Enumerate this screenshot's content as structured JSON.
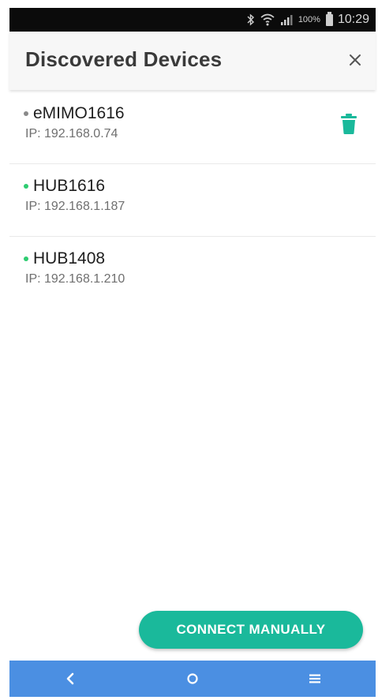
{
  "status_bar": {
    "icons": [
      "bluetooth-icon",
      "wifi-icon",
      "signal-icon",
      "battery-icon"
    ],
    "battery": "100%",
    "time": "10:29"
  },
  "header": {
    "title": "Discovered Devices",
    "close_icon": "close-icon"
  },
  "devices": [
    {
      "name": "eMIMO1616",
      "ip": "IP: 192.168.0.74",
      "status_color": "#8a8a8a",
      "status": "offline",
      "deletable": true
    },
    {
      "name": "HUB1616",
      "ip": "IP: 192.168.1.187",
      "status_color": "#2ecc71",
      "status": "online",
      "deletable": false
    },
    {
      "name": "HUB1408",
      "ip": "IP: 192.168.1.210",
      "status_color": "#2ecc71",
      "status": "online",
      "deletable": false
    }
  ],
  "connect_button": {
    "label": "CONNECT MANUALLY"
  },
  "nav_bar": {
    "icons": [
      "back-icon",
      "home-icon",
      "menu-icon"
    ]
  },
  "colors": {
    "accent": "#1ab99b",
    "nav_bar": "#4b8fe2",
    "status_bar": "#0b0b0b",
    "header_bg": "#f7f7f7"
  }
}
